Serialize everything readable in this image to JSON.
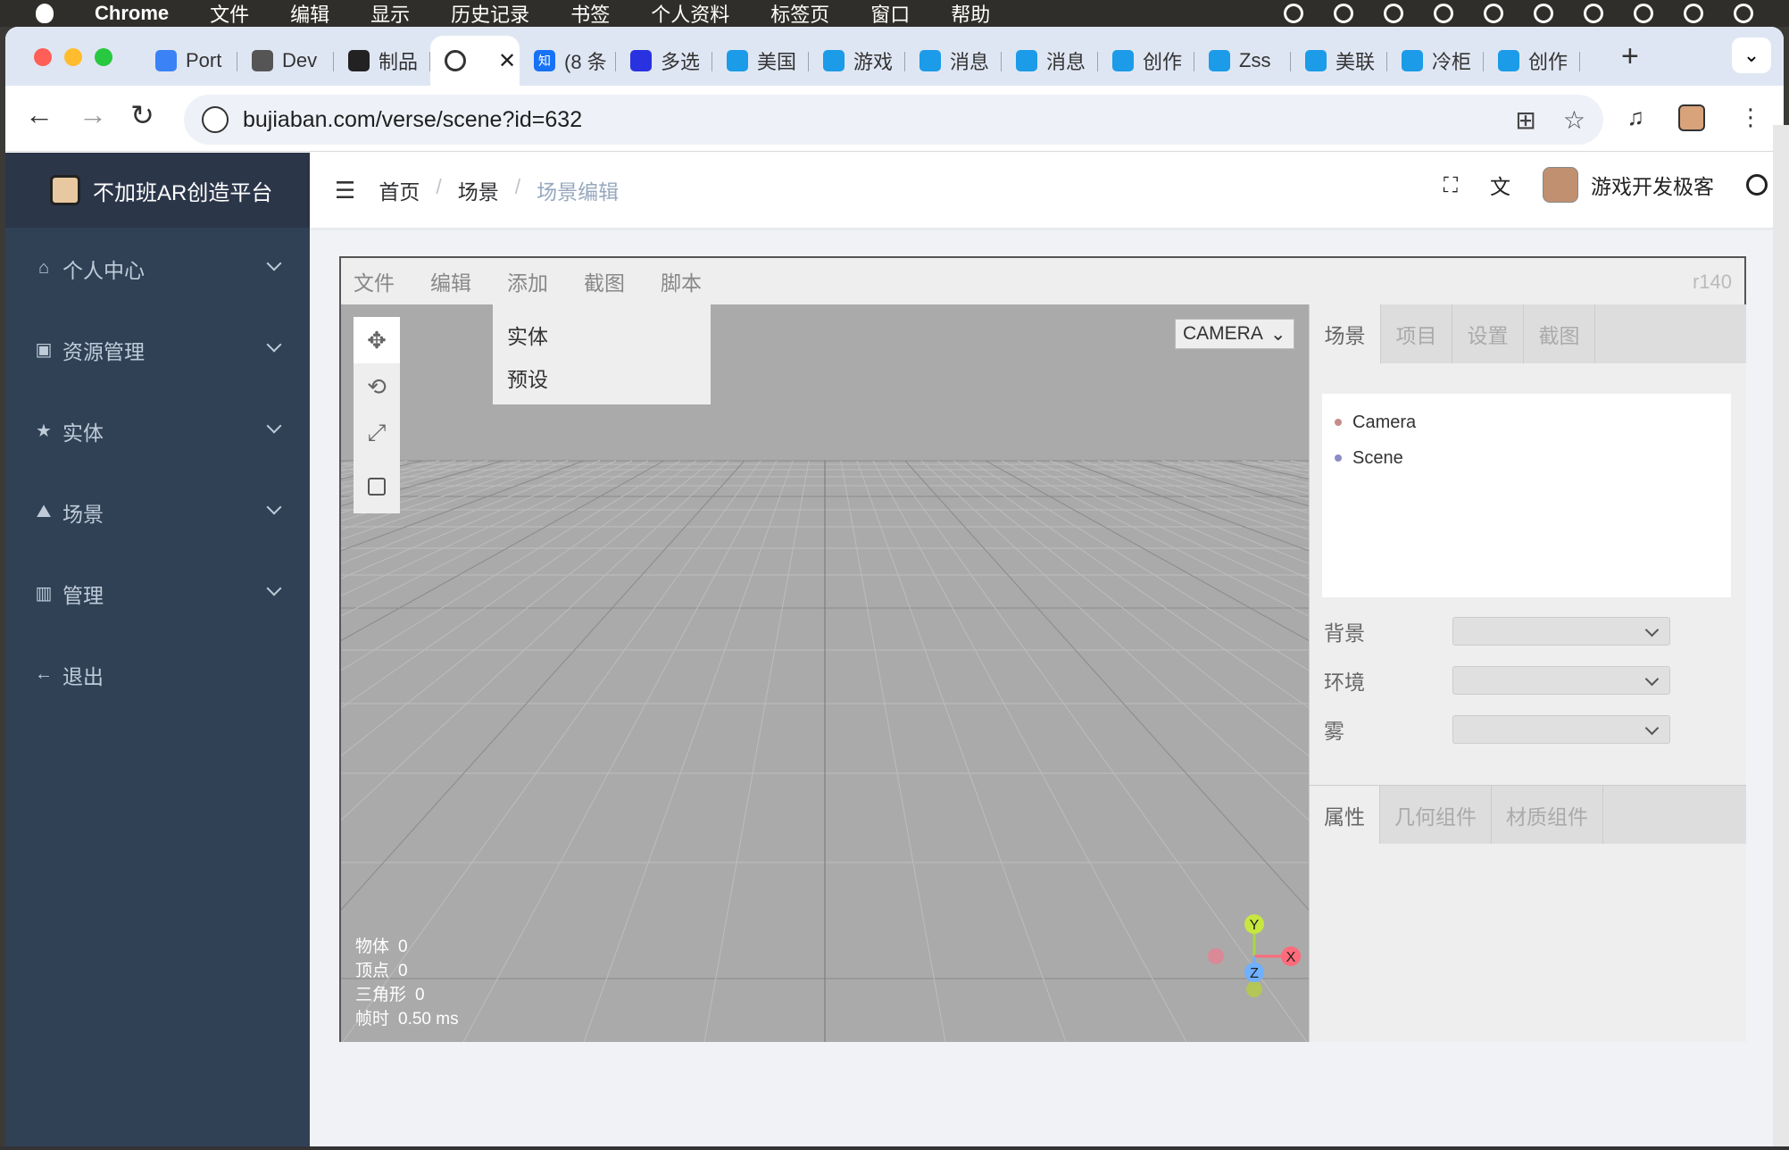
{
  "macos": {
    "app_name": "Chrome",
    "menus": [
      "文件",
      "编辑",
      "显示",
      "历史记录",
      "书签",
      "个人资料",
      "标签页",
      "窗口",
      "帮助"
    ]
  },
  "browser": {
    "tabs": [
      {
        "label": "Port",
        "icon": "python-icon",
        "color": "#3b82f6"
      },
      {
        "label": "Dev",
        "icon": "devtools-icon",
        "color": "#555555"
      },
      {
        "label": "制品",
        "icon": "app-icon",
        "color": "#222222"
      },
      {
        "label": "",
        "icon": "globe-icon",
        "color": "#333333",
        "active": true
      },
      {
        "label": "(8 条",
        "icon": "zhihu-icon",
        "color": "#1772f6",
        "fav_text": "知"
      },
      {
        "label": "多选",
        "icon": "baidu-icon",
        "color": "#2932e1"
      },
      {
        "label": "美国",
        "icon": "bilibili-icon",
        "color": "#1b9be8"
      },
      {
        "label": "游戏",
        "icon": "bilibili-icon",
        "color": "#1b9be8"
      },
      {
        "label": "消息",
        "icon": "bilibili-icon",
        "color": "#1b9be8"
      },
      {
        "label": "消息",
        "icon": "bilibili-icon",
        "color": "#1b9be8"
      },
      {
        "label": "创作",
        "icon": "bilibili-icon",
        "color": "#1b9be8"
      },
      {
        "label": "Zss",
        "icon": "bilibili-icon",
        "color": "#1b9be8"
      },
      {
        "label": "美联",
        "icon": "bilibili-icon",
        "color": "#1b9be8"
      },
      {
        "label": "冷柜",
        "icon": "bilibili-icon",
        "color": "#1b9be8"
      },
      {
        "label": "创作",
        "icon": "bilibili-icon",
        "color": "#1b9be8"
      }
    ],
    "new_tab": "+",
    "url": "bujiaban.com/verse/scene?id=632"
  },
  "app": {
    "logo_text": "不加班AR创造平台",
    "sidebar": [
      {
        "label": "个人中心",
        "icon": "home-icon",
        "glyph": "⌂",
        "expandable": true
      },
      {
        "label": "资源管理",
        "icon": "resource-icon",
        "glyph": "▣",
        "expandable": true
      },
      {
        "label": "实体",
        "icon": "star-icon",
        "glyph": "★",
        "expandable": true
      },
      {
        "label": "场景",
        "icon": "scene-icon",
        "glyph": "⛰",
        "expandable": true
      },
      {
        "label": "管理",
        "icon": "manage-icon",
        "glyph": "▥",
        "expandable": true
      },
      {
        "label": "退出",
        "icon": "back-arrow-icon",
        "glyph": "←",
        "expandable": false
      }
    ],
    "breadcrumb": [
      "首页",
      "场景",
      "场景编辑"
    ],
    "breadcrumb_sep": "/",
    "user_name": "游戏开发极客"
  },
  "editor": {
    "menus": [
      "文件",
      "编辑",
      "添加",
      "截图",
      "脚本"
    ],
    "version": "r140",
    "add_menu": [
      "实体",
      "预设"
    ],
    "camera_select": "CAMERA",
    "stats": [
      {
        "label": "物体",
        "value": "0"
      },
      {
        "label": "顶点",
        "value": "0"
      },
      {
        "label": "三角形",
        "value": "0"
      },
      {
        "label": "帧时",
        "value": "0.50 ms"
      }
    ],
    "axes": {
      "x": "X",
      "y": "Y",
      "z": "Z"
    },
    "panel_tabs": [
      "场景",
      "项目",
      "设置",
      "截图"
    ],
    "outliner": [
      {
        "label": "Camera",
        "dot_color": "#c88b8b"
      },
      {
        "label": "Scene",
        "dot_color": "#8b8bc8"
      }
    ],
    "scene_props": [
      {
        "label": "背景",
        "value": ""
      },
      {
        "label": "环境",
        "value": ""
      },
      {
        "label": "雾",
        "value": ""
      }
    ],
    "bottom_tabs": [
      "属性",
      "几何组件",
      "材质组件"
    ]
  }
}
